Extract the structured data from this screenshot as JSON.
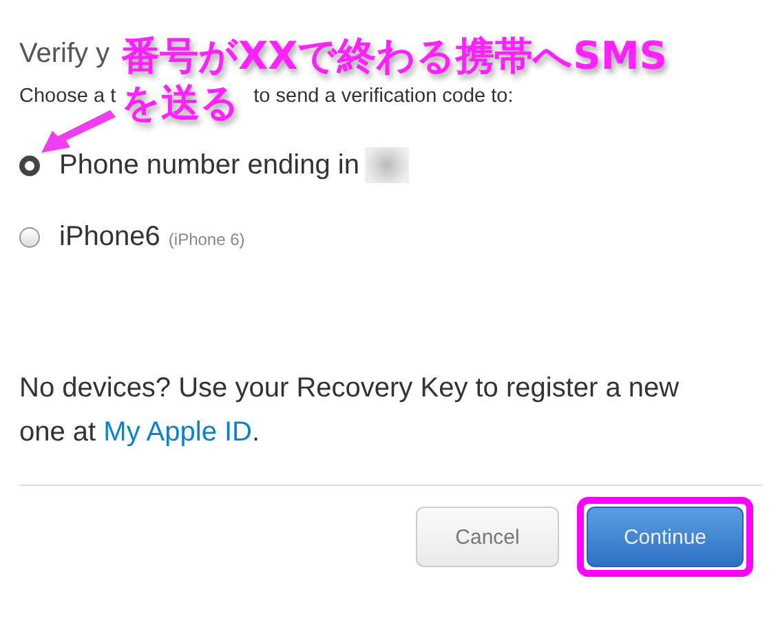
{
  "heading": "Verify y",
  "subtitle": [
    "Choose a t",
    "to send a verification code to:"
  ],
  "options": [
    {
      "kind": "redacted",
      "label": "Phone number ending in",
      "selected": true
    },
    {
      "kind": "device",
      "label": "iPhone6",
      "detail": "(iPhone 6)",
      "selected": false
    }
  ],
  "note": {
    "text": "No devices? Use your Recovery Key to register a new one at ",
    "link": "My Apple ID",
    "end": "."
  },
  "buttons": [
    {
      "label": "Cancel",
      "kind": "secondary",
      "highlighted": false
    },
    {
      "label": "Continue",
      "kind": "primary",
      "highlighted": true
    }
  ],
  "annotation": {
    "lines": [
      "番号がXXで終わる携帯へSMS",
      "を送る"
    ]
  }
}
